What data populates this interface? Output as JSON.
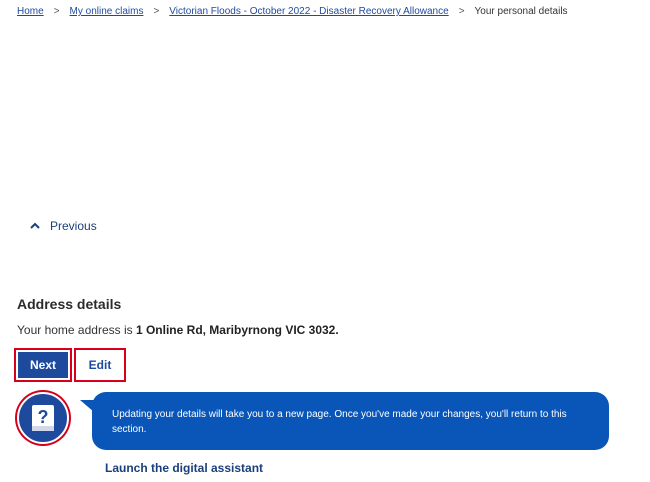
{
  "breadcrumb": {
    "items": [
      "Home",
      "My online claims",
      "Victorian Floods - October 2022 - Disaster Recovery Allowance"
    ],
    "current": "Your personal details",
    "separator": ">"
  },
  "previous": {
    "label": "Previous",
    "icon": "chevron-up-icon"
  },
  "address_section": {
    "heading": "Address details",
    "prefix": "Your home address is ",
    "address": "1 Online Rd, Maribyrnong VIC 3032."
  },
  "actions": {
    "next_label": "Next",
    "edit_label": "Edit"
  },
  "assistant": {
    "icon": "question-book-icon",
    "message": "Updating your details will take you to a new page. Once you've made your changes, you'll return to this section.",
    "launch_label": "Launch the digital assistant"
  },
  "colors": {
    "primary": "#1e4a9e",
    "bubble": "#0a56b8",
    "highlight": "#d6001c"
  }
}
